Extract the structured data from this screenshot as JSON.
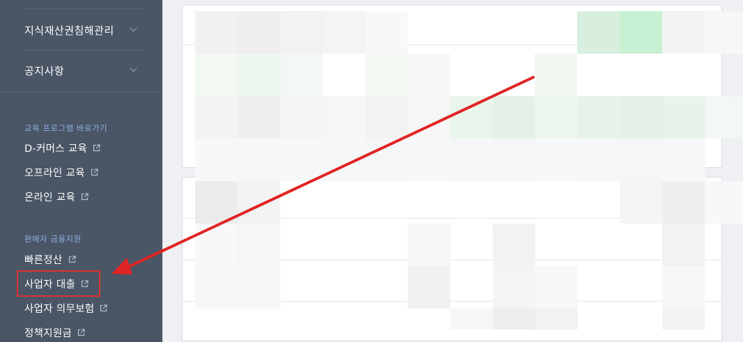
{
  "sidebar": {
    "menu": [
      {
        "label": "지식재산권침해관리"
      },
      {
        "label": "공지사항"
      }
    ],
    "sections": [
      {
        "title": "교육 프로그램 바로가기",
        "links": [
          {
            "label": "D-커머스 교육",
            "icon": "external-link-icon"
          },
          {
            "label": "오프라인 교육",
            "icon": "external-link-icon"
          },
          {
            "label": "온라인 교육",
            "icon": "external-link-icon"
          }
        ]
      },
      {
        "title": "판매자 금융지원",
        "links": [
          {
            "label": "빠른정산",
            "icon": "external-link-icon"
          },
          {
            "label": "사업자 대출",
            "icon": "external-link-icon"
          },
          {
            "label": "사업자 의무보험",
            "icon": "external-link-icon"
          },
          {
            "label": "정책지원금",
            "icon": "external-link-icon"
          }
        ]
      }
    ]
  },
  "annotation": {
    "highlight_color": "#e03131",
    "arrow_color": "#e02424",
    "target": "사업자 대출"
  },
  "colors": {
    "sidebar_bg": "#4a5565",
    "section_title": "#8db1e6",
    "page_bg": "#eef0f3"
  }
}
